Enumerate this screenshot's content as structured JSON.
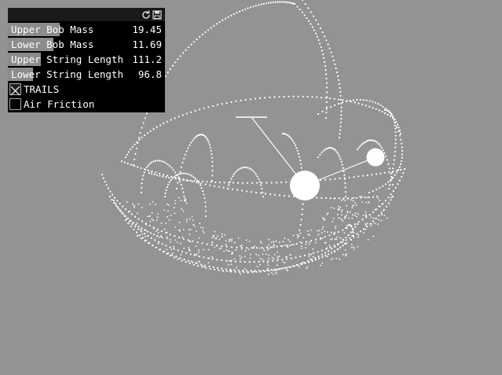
{
  "panel": {
    "icons": {
      "refresh": "refresh-icon",
      "save": "save-icon"
    },
    "sliders": [
      {
        "label": "Upper Bob Mass",
        "value": "19.45",
        "level": 0.33
      },
      {
        "label": "Lower Bob Mass",
        "value": "11.69",
        "level": 0.29
      },
      {
        "label": "Upper String Length",
        "value": "111.2",
        "level": 0.21
      },
      {
        "label": "Lower String Length",
        "value": "96.8",
        "level": 0.16
      }
    ],
    "toggles": [
      {
        "label": "TRAILS",
        "checked": true
      },
      {
        "label": "Air Friction",
        "checked": false
      }
    ]
  },
  "colors": {
    "background": "#939393",
    "trail": "#ffffff",
    "panel": "#000000",
    "slider_fill": "#8c8c8c"
  }
}
